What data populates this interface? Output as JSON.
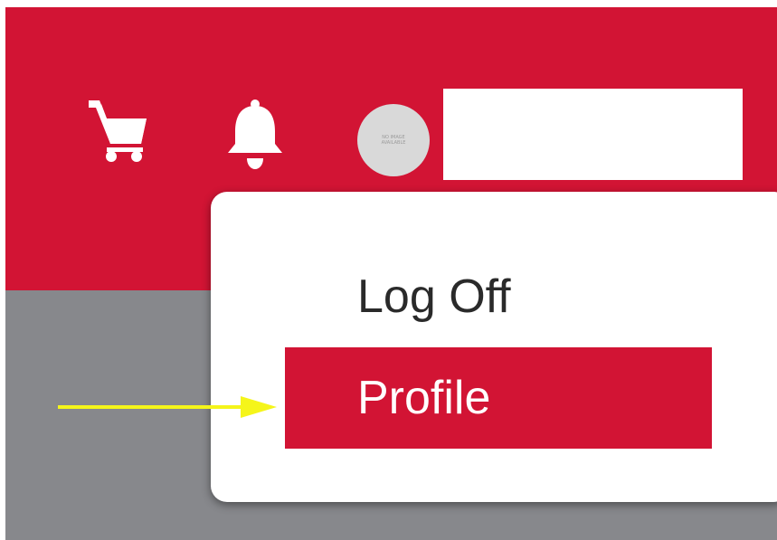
{
  "header": {
    "icons": {
      "cart": "cart-icon",
      "notifications": "bell-icon"
    },
    "avatar": {
      "placeholder_text": "NO IMAGE\nAVAILABLE"
    },
    "username": ""
  },
  "user_menu": {
    "items": [
      {
        "label": "Log Off",
        "selected": false
      },
      {
        "label": "Profile",
        "selected": true
      }
    ]
  },
  "annotation": {
    "type": "arrow",
    "target": "Profile",
    "color": "#f5f51a"
  },
  "colors": {
    "brand_red": "#d21434",
    "content_gray": "#87888c",
    "menu_background": "#ffffff",
    "menu_text": "#2a2a2a",
    "avatar_background": "#d9d9d9",
    "arrow_yellow": "#f5f51a"
  }
}
